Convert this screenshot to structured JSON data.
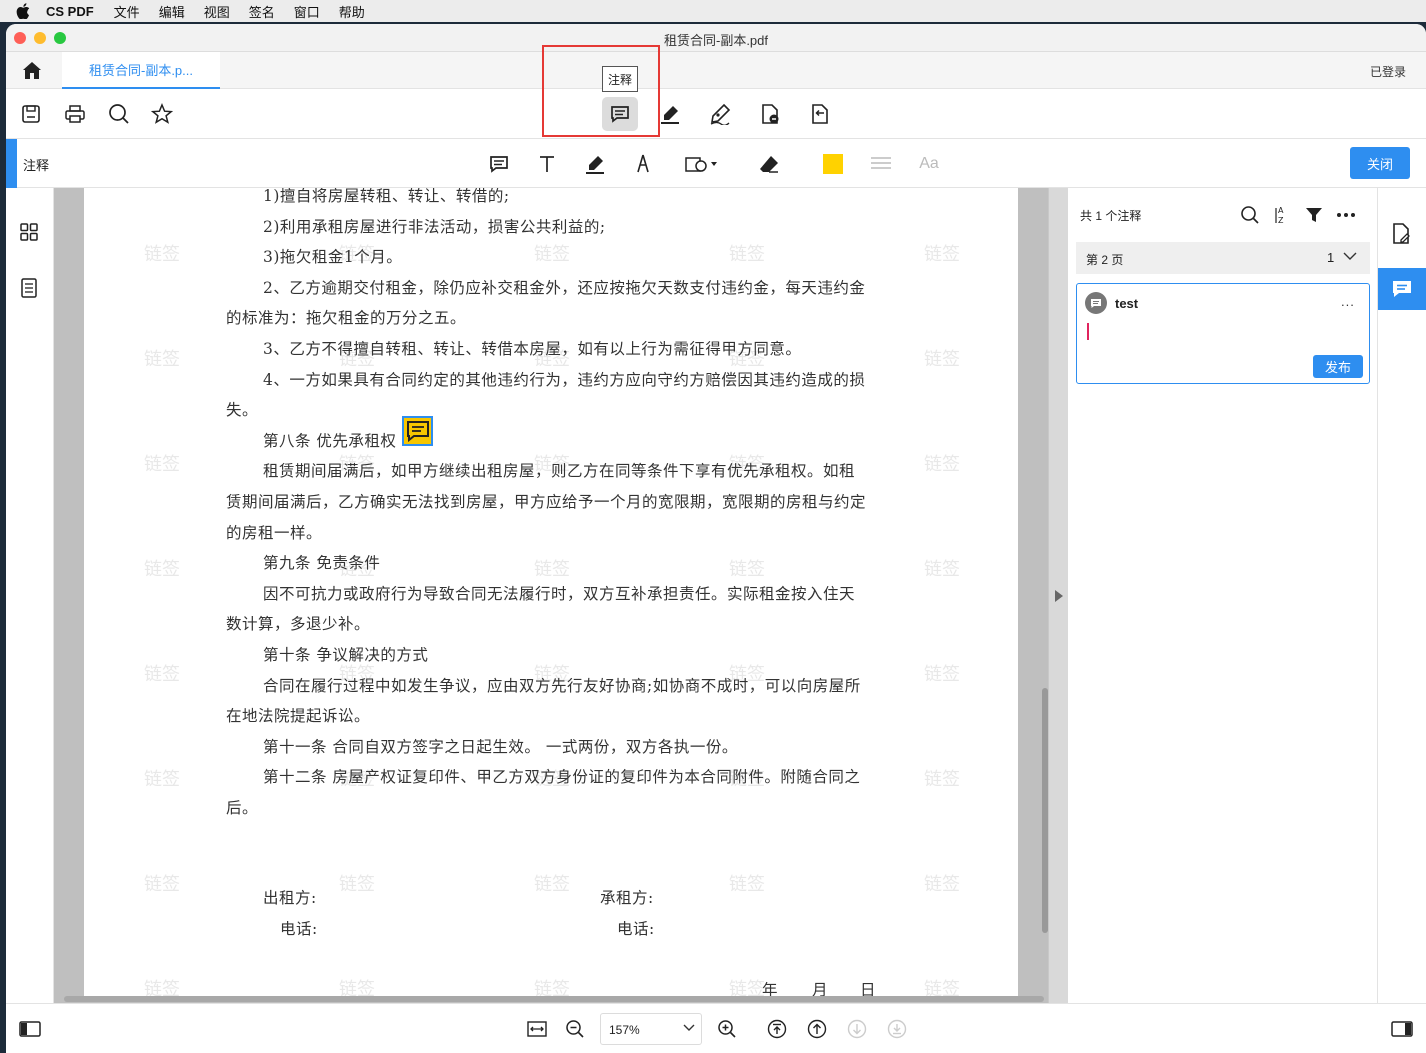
{
  "menubar": {
    "app_name": "CS PDF",
    "items": [
      "文件",
      "编辑",
      "视图",
      "签名",
      "窗口",
      "帮助"
    ]
  },
  "window": {
    "title": "租赁合同-副本.pdf",
    "tab_label": "租赁合同-副本.p...",
    "login_status": "已登录"
  },
  "toolbar": {
    "tooltip": "注释",
    "icons": [
      "save-icon",
      "print-icon",
      "search-icon",
      "star-icon",
      "comment-icon",
      "highlighter-icon",
      "signature-pen-icon",
      "document-stamp-icon",
      "document-convert-icon"
    ]
  },
  "annotation_bar": {
    "label": "注释",
    "close_label": "关闭",
    "highlight_color": "#ffd200",
    "font_label": "Aa"
  },
  "document": {
    "watermark": "链签",
    "lines": [
      "1)擅自将房屋转租、转让、转借的;",
      "2)利用承租房屋进行非法活动，损害公共利益的;",
      "3)拖欠租金1个月。",
      "2、乙方逾期交付租金，除仍应补交租金外，还应按拖欠天数支付违约金，每天违约金",
      "的标准为：拖欠租金的万分之五。",
      "3、乙方不得擅自转租、转让、转借本房屋，如有以上行为需征得甲方同意。",
      "4、一方如果具有合同约定的其他违约行为，违约方应向守约方赔偿因其违约造成的损",
      "失。",
      "第八条  优先承租权",
      "租赁期间届满后，如甲方继续出租房屋，则乙方在同等条件下享有优先承租权。如租",
      "赁期间届满后，乙方确实无法找到房屋，甲方应给予一个月的宽限期，宽限期的房租与约定",
      "的房租一样。",
      "第九条  免责条件",
      "因不可抗力或政府行为导致合同无法履行时，双方互补承担责任。实际租金按入住天",
      "数计算，多退少补。",
      "第十条  争议解决的方式",
      "合同在履行过程中如发生争议，应由双方先行友好协商;如协商不成时，可以向房屋所",
      "在地法院提起诉讼。",
      "第十一条  合同自双方签字之日起生效。  一式两份，双方各执一份。",
      "第十二条  房屋产权证复印件、甲乙方双方身份证的复印件为本合同附件。附随合同之",
      "后。"
    ],
    "signatures": {
      "lessor": "出租方:",
      "lessee": "承租方:",
      "phone1": "电话:",
      "phone2": "电话:",
      "year": "年",
      "month": "月",
      "day": "日"
    }
  },
  "comments_panel": {
    "count_label": "共 1 个注释",
    "page_label": "第 2 页",
    "page_count": "1",
    "comment": {
      "author": "test",
      "more": "...",
      "publish_label": "发布"
    }
  },
  "bottombar": {
    "zoom": "157%"
  }
}
